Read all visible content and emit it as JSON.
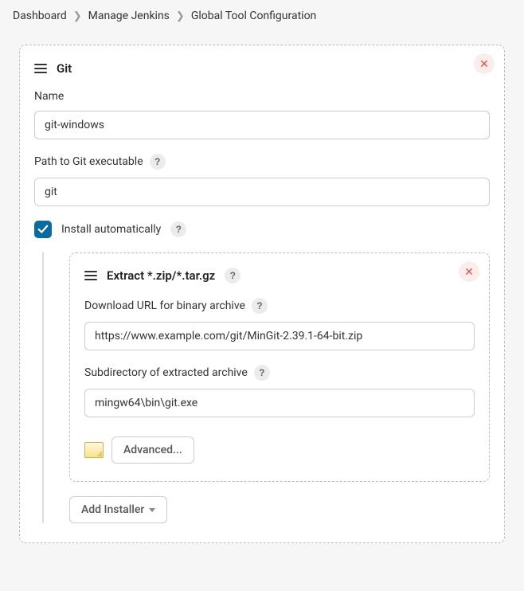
{
  "breadcrumb": {
    "items": [
      "Dashboard",
      "Manage Jenkins",
      "Global Tool Configuration"
    ]
  },
  "git_section": {
    "title": "Git",
    "fields": {
      "name_label": "Name",
      "name_value": "git-windows",
      "path_label": "Path to Git executable",
      "path_value": "git",
      "install_auto_label": "Install automatically",
      "install_auto_checked": true
    }
  },
  "installer": {
    "title": "Extract *.zip/*.tar.gz",
    "url_label": "Download URL for binary archive",
    "url_value": "https://www.example.com/git/MinGit-2.39.1-64-bit.zip",
    "subdir_label": "Subdirectory of extracted archive",
    "subdir_value": "mingw64\\bin\\git.exe",
    "advanced_label": "Advanced..."
  },
  "add_installer_label": "Add Installer"
}
